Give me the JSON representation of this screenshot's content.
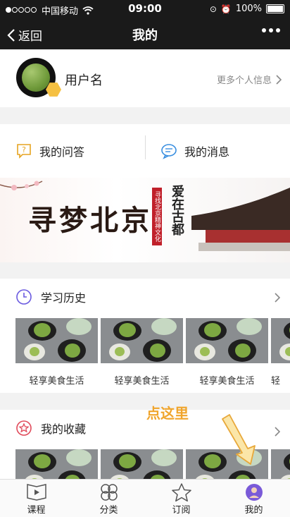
{
  "status": {
    "carrier": "中国移动",
    "time": "09:00",
    "battery": "100%"
  },
  "nav": {
    "back": "返回",
    "title": "我的"
  },
  "profile": {
    "username": "用户名",
    "more": "更多个人信息"
  },
  "qa": {
    "questions": "我的问答",
    "messages": "我的消息"
  },
  "banner": {
    "title": "寻梦北京",
    "tag": "寻找北京精神文化",
    "slogan": "爱在古都"
  },
  "history": {
    "title": "学习历史",
    "items": [
      "轻享美食生活",
      "轻享美食生活",
      "轻享美食生活",
      "轻"
    ]
  },
  "favorites": {
    "title": "我的收藏",
    "hint": "点这里"
  },
  "tabs": [
    "课程",
    "分类",
    "订阅",
    "我的"
  ]
}
